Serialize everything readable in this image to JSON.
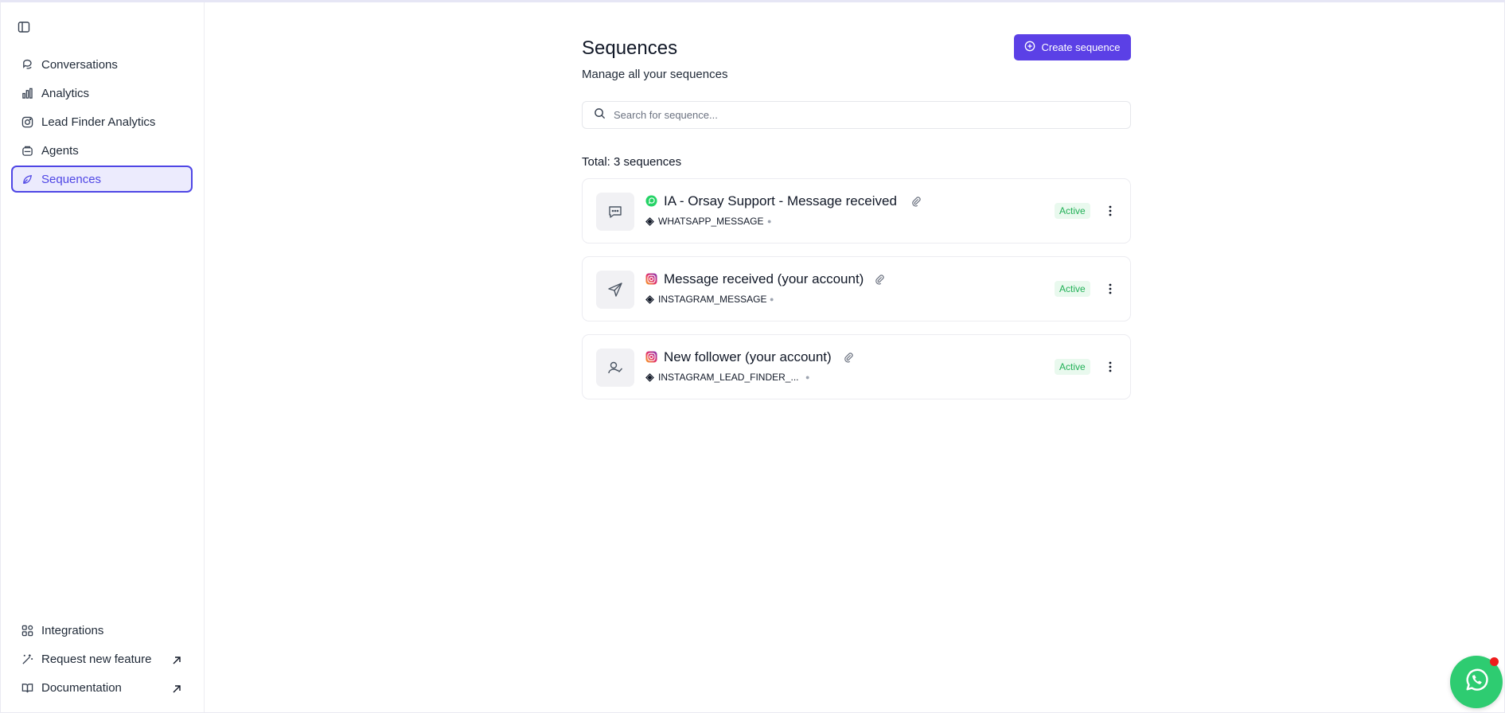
{
  "sidebar": {
    "items": [
      {
        "label": "Conversations",
        "icon": "chat-bubble-icon"
      },
      {
        "label": "Analytics",
        "icon": "bar-chart-icon"
      },
      {
        "label": "Lead Finder Analytics",
        "icon": "instagram-icon"
      },
      {
        "label": "Agents",
        "icon": "agent-icon"
      },
      {
        "label": "Sequences",
        "icon": "sequence-icon",
        "active": true
      }
    ],
    "bottom": [
      {
        "label": "Integrations",
        "icon": "grid-icon"
      },
      {
        "label": "Request new feature",
        "icon": "wand-icon",
        "external": true
      },
      {
        "label": "Documentation",
        "icon": "book-icon",
        "external": true
      }
    ]
  },
  "main": {
    "title": "Sequences",
    "subtitle": "Manage all your sequences",
    "create_label": "Create sequence",
    "search_placeholder": "Search for sequence...",
    "total": "Total: 3 sequences"
  },
  "sequences": [
    {
      "name": "IA - Orsay Support - Message received",
      "channel": "whatsapp",
      "type": "WHATSAPP_MESSAGE",
      "status": "Active",
      "thumb": "chat-icon"
    },
    {
      "name": "Message received (your account)",
      "channel": "instagram",
      "type": "INSTAGRAM_MESSAGE",
      "status": "Active",
      "thumb": "send-icon"
    },
    {
      "name": "New follower (your account)",
      "channel": "instagram",
      "type": "INSTAGRAM_LEAD_FINDER_...",
      "status": "Active",
      "thumb": "user-check-icon"
    }
  ],
  "colors": {
    "accent": "#5b40e6",
    "active_bg": "#ecebfd",
    "status_green": "#22b057",
    "whatsapp": "#2ecc71"
  }
}
